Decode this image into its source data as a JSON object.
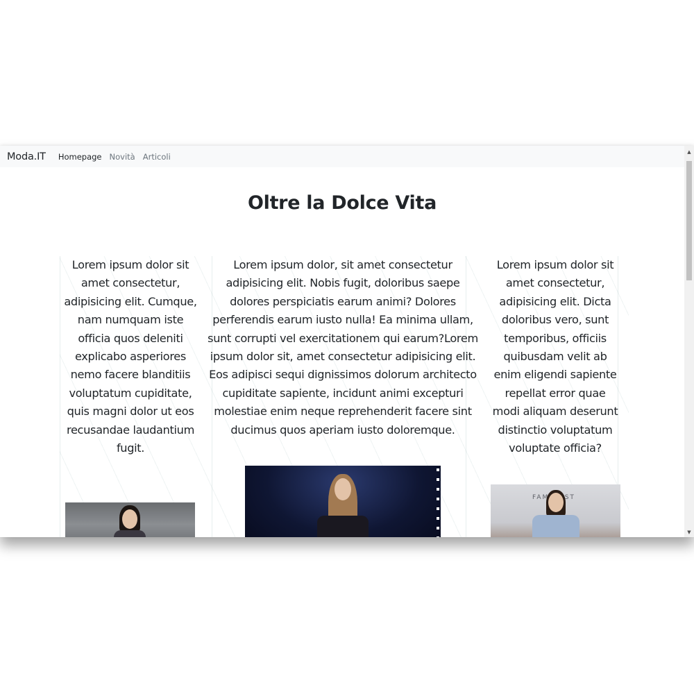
{
  "navbar": {
    "brand": "Moda.IT",
    "links": [
      {
        "label": "Homepage",
        "active": true
      },
      {
        "label": "Novità",
        "active": false
      },
      {
        "label": "Articoli",
        "active": false
      }
    ]
  },
  "main": {
    "title": "Oltre la Dolce Vita",
    "columns": [
      {
        "text": "Lorem ipsum dolor sit amet consectetur, adipisicing elit. Cumque, nam numquam iste officia quos deleniti explicabo asperiores nemo facere blanditiis voluptatum cupiditate, quis magni dolor ut eos recusandae laudantium fugit."
      },
      {
        "text": "Lorem ipsum dolor, sit amet consectetur adipisicing elit. Nobis fugit, doloribus saepe dolores perspiciatis earum animi? Dolores perferendis earum iusto nulla! Ea minima ullam, sunt corrupti vel exercitationem qui earum?Lorem ipsum dolor sit, amet consectetur adipisicing elit. Eos adipisci sequi dignissimos dolorum architecto cupiditate sapiente, incidunt animi excepturi molestiae enim neque reprehenderit facere sint ducimus quos aperiam iusto doloremque."
      },
      {
        "text": "Lorem ipsum dolor sit amet consectetur, adipisicing elit. Dicta doloribus vero, sunt temporibus, officiis quibusdam velit ab enim eligendi sapiente repellat error quae modi aliquam deserunt distinctio voluptatum voluptate officia?"
      }
    ],
    "photos": [
      {
        "icon": "model-photo"
      },
      {
        "icon": "runway-photo"
      },
      {
        "icon": "model-photo",
        "caption": "FAMI  IRST"
      }
    ]
  },
  "scrollbar": {
    "up_icon": "▲",
    "down_icon": "▼"
  },
  "colors": {
    "navbar_bg": "#f8f9fa",
    "text": "#212529",
    "muted_link": "#6c757d"
  }
}
